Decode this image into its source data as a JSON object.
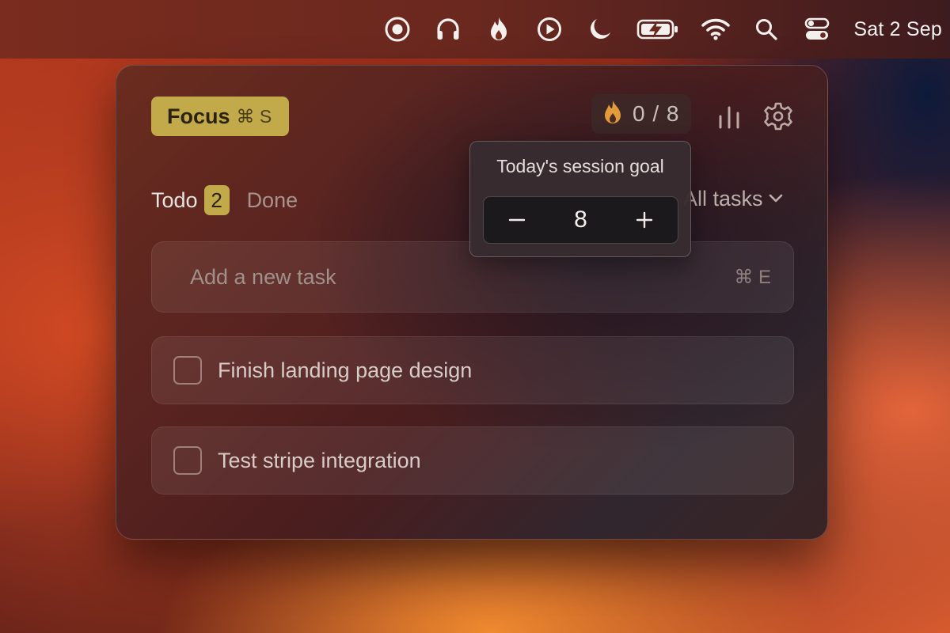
{
  "menubar": {
    "icons": [
      "record-icon",
      "headphones-icon",
      "flame-icon",
      "play-icon",
      "moon-icon",
      "battery-charging-icon",
      "wifi-icon",
      "search-icon",
      "control-center-icon"
    ],
    "clock": "Sat 2 Sep"
  },
  "panel": {
    "focus": {
      "label": "Focus",
      "shortcut": "⌘ S"
    },
    "streak": {
      "icon": "flame-icon",
      "progress": "0 / 8"
    },
    "tabs": {
      "todo_label": "Todo",
      "todo_count": "2",
      "done_label": "Done"
    },
    "filter": {
      "label": "All tasks"
    },
    "new_task": {
      "placeholder": "Add a new task",
      "shortcut": "⌘ E"
    },
    "tasks": [
      {
        "title": "Finish landing page design",
        "done": false
      },
      {
        "title": "Test stripe integration",
        "done": false
      }
    ],
    "goal_popover": {
      "title": "Today's session goal",
      "decrement": "−",
      "value": "8",
      "increment": "+"
    }
  },
  "colors": {
    "accent": "#c2a94a",
    "flame": "#e39a3a"
  }
}
